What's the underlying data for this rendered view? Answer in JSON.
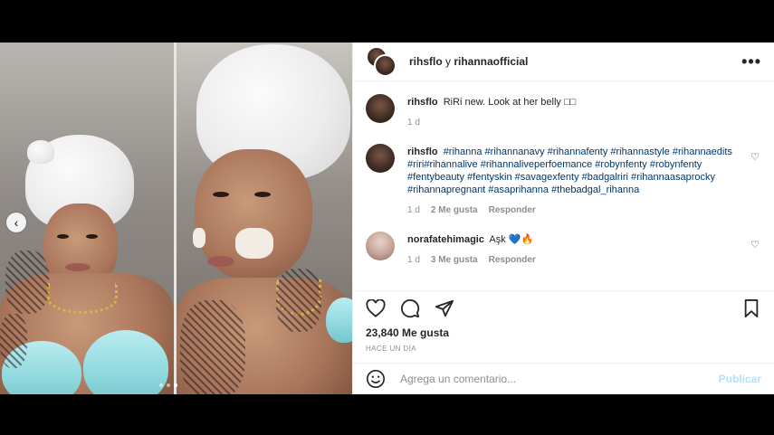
{
  "header": {
    "user1": "rihsflo",
    "separator": " y ",
    "user2": "rihannaofficial",
    "more_icon": "more-horizontal-icon"
  },
  "caption": {
    "username": "rihsflo",
    "text": "RiRi new. Look at her belly",
    "emoji": "□□",
    "time": "1 d"
  },
  "comments": [
    {
      "username": "rihsflo",
      "hashtags": "#rihanna #rihannanavy #rihannafenty #rihannastyle #rihannaedits #riri#rihannalive #rihannaliveperfoemance #robynfenty #robynfenty #fentybeauty #fentyskin #savagexfenty #badgalriri #rihannaasaprocky #rihannapregnant #asaprihanna #thebadgal_rihanna",
      "time": "1 d",
      "likes": "2 Me gusta",
      "reply": "Responder"
    },
    {
      "username": "norafatehimagic",
      "text": "Aşk",
      "emoji_heart": "💙",
      "emoji_fire": "🔥",
      "time": "1 d",
      "likes": "3 Me gusta",
      "reply": "Responder"
    }
  ],
  "actions": {
    "likes_count": "23,840 Me gusta",
    "timestamp": "HACE UN DÍA"
  },
  "add_comment": {
    "placeholder": "Agrega un comentario...",
    "publish_label": "Publicar"
  },
  "carousel": {
    "prev_icon": "chevron-left-icon",
    "slide_count": 3,
    "active_slide": 3
  },
  "colors": {
    "link": "#00376b",
    "muted": "#8e8e8e",
    "publish_disabled": "#b2dffc"
  }
}
